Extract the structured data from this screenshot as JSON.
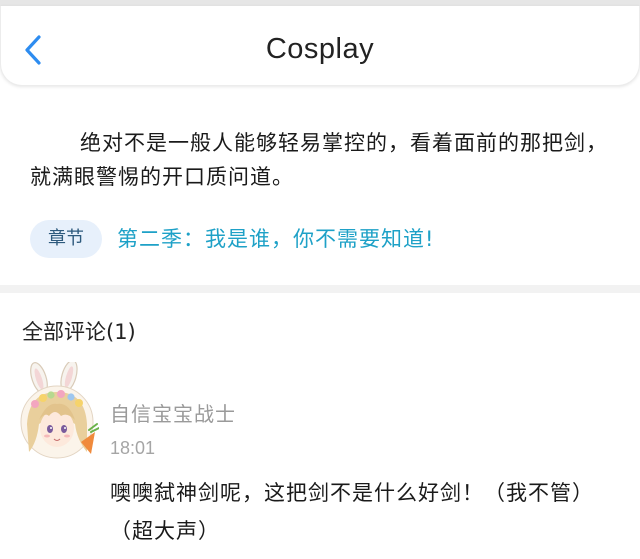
{
  "header": {
    "title": "Cosplay",
    "back_icon": "chevron-left-icon",
    "accent_color": "#2d8cf0"
  },
  "content": {
    "summary": "绝对不是一般人能够轻易掌控的，看着面前的那把剑，就满眼警惕的开口质问道。",
    "chapter_badge": "章节",
    "chapter_title": "第二季：我是谁，你不需要知道!"
  },
  "comments": {
    "title": "全部评论(1)",
    "items": [
      {
        "author": "自信宝宝战士",
        "time": "18:01",
        "text": "噢噢弑神剑呢，这把剑不是什么好剑！（我不管）（超大声）",
        "avatar_icon": "anime-girl-bunny-ears-avatar"
      }
    ]
  },
  "colors": {
    "link": "#1ea1c7",
    "badge_bg": "#e7f0fb",
    "muted_text": "#9a9a9a"
  }
}
